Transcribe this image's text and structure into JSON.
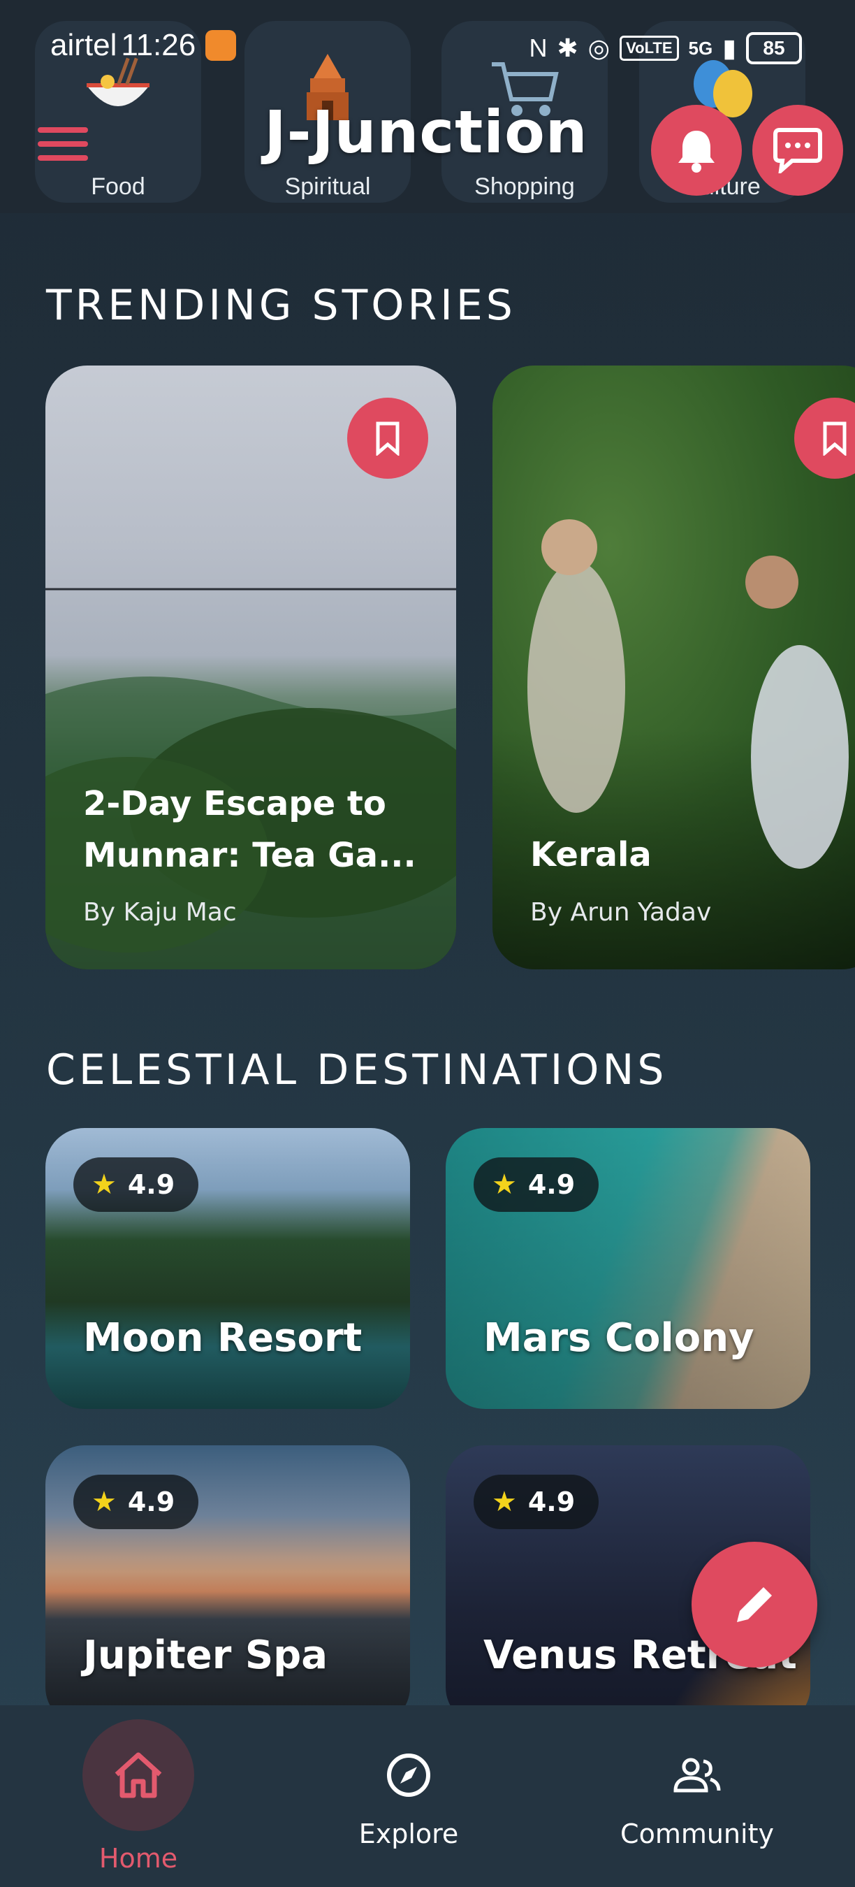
{
  "status_bar": {
    "carrier": "airtel",
    "time": "11:26",
    "network_tag": "VoLTE",
    "network_gen": "5G",
    "battery": "85"
  },
  "header": {
    "title": "J-Junction",
    "categories": [
      {
        "label": "Food",
        "icon": "noodle-bowl-icon"
      },
      {
        "label": "Spiritual",
        "icon": "temple-icon"
      },
      {
        "label": "Shopping",
        "icon": "shopping-cart-icon"
      },
      {
        "label": "Culture",
        "icon": "theater-masks-icon"
      }
    ]
  },
  "sections": {
    "trending_title": "TRENDING STORIES",
    "destinations_title": "CELESTIAL DESTINATIONS"
  },
  "stories": [
    {
      "title": "2-Day Escape to Munnar: Tea Ga...",
      "author": "By Kaju Mac"
    },
    {
      "title": "Kerala",
      "author": "By Arun Yadav"
    }
  ],
  "destinations": [
    {
      "name": "Moon Resort",
      "rating": "4.9"
    },
    {
      "name": "Mars Colony",
      "rating": "4.9"
    },
    {
      "name": "Jupiter Spa",
      "rating": "4.9"
    },
    {
      "name": "Venus Retreat",
      "rating": "4.9"
    }
  ],
  "bottom_nav": {
    "items": [
      {
        "label": "Home",
        "icon": "home-icon",
        "active": true
      },
      {
        "label": "Explore",
        "icon": "compass-icon",
        "active": false
      },
      {
        "label": "Community",
        "icon": "people-icon",
        "active": false
      }
    ]
  },
  "colors": {
    "accent": "#df4a5f",
    "background": "#22333f",
    "nav_background": "#243441",
    "star": "#f3d31c"
  }
}
